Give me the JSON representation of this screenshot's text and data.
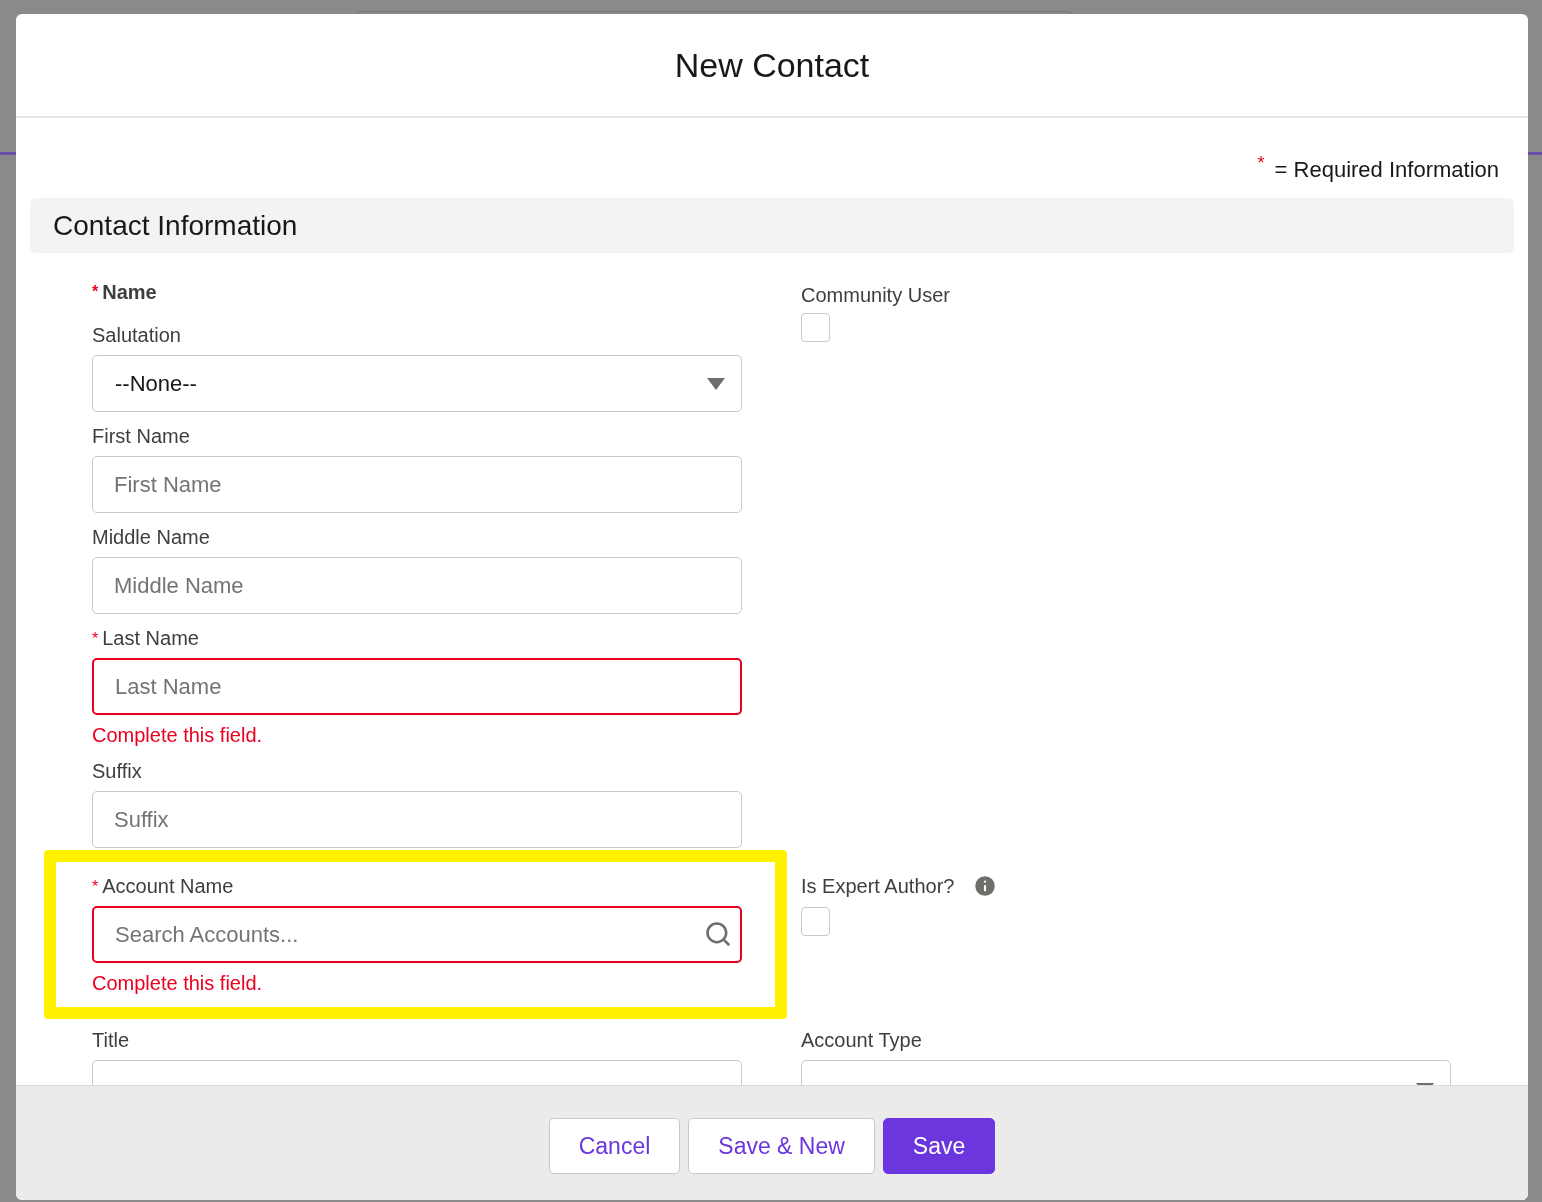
{
  "modal": {
    "title": "New Contact",
    "legend": {
      "mark": "*",
      "text": "= Required Information"
    }
  },
  "section": {
    "title": "Contact Information"
  },
  "name_block": {
    "label": "Name",
    "required": true,
    "fields": [
      {
        "kind": "select",
        "label": "Salutation",
        "value": "--None--",
        "required": false
      },
      {
        "kind": "text",
        "label": "First Name",
        "placeholder": "First Name",
        "required": false
      },
      {
        "kind": "text",
        "label": "Middle Name",
        "placeholder": "Middle Name",
        "required": false
      },
      {
        "kind": "text",
        "label": "Last Name",
        "placeholder": "Last Name",
        "required": true,
        "error": "Complete this field."
      },
      {
        "kind": "text",
        "label": "Suffix",
        "placeholder": "Suffix",
        "required": false
      }
    ]
  },
  "community_user": {
    "label": "Community User",
    "checked": false
  },
  "account_name": {
    "kind": "lookup",
    "label": "Account Name",
    "placeholder": "Search Accounts...",
    "required": true,
    "error": "Complete this field.",
    "highlighted": true
  },
  "expert_author": {
    "label": "Is Expert Author?",
    "checked": false,
    "info": true
  },
  "lower_fields": [
    {
      "kind": "text",
      "label": "Title",
      "required": false
    },
    {
      "kind": "select",
      "label": "Account Type",
      "required": false
    }
  ],
  "footer_buttons": [
    {
      "label": "Cancel",
      "kind": "neutral"
    },
    {
      "label": "Save & New",
      "kind": "neutral"
    },
    {
      "label": "Save",
      "kind": "brand"
    }
  ]
}
